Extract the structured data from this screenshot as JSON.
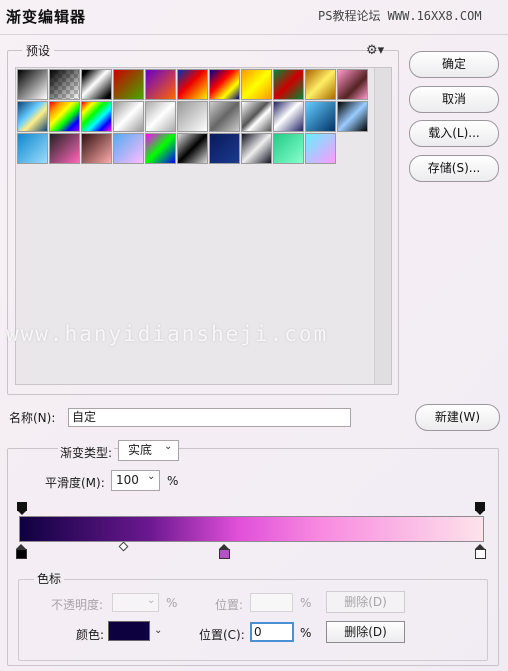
{
  "window": {
    "title": "渐变编辑器",
    "watermark": "PS教程论坛 WWW.16XX8.COM"
  },
  "presets": {
    "label": "预设",
    "menu_icon": "gear-icon",
    "swatches": [
      [
        "linear-gradient(135deg,#000 0%,#fff 100%)",
        "linear-gradient(135deg,#000 0%,transparent 100%)",
        "linear-gradient(135deg,#000 10%,#fff 45%,#000 90%)",
        "linear-gradient(135deg,#c00 0%,#4a0 100%)",
        "linear-gradient(135deg,#60c 0%,#f60 100%)",
        "linear-gradient(135deg,#03a 0%,#e00 45%,#fe0 100%)",
        "linear-gradient(135deg,#008 0%,#f00 40%,#ff0 70%,#008 100%)",
        "linear-gradient(135deg,#f90 0%,#ff0 50%,#f90 100%)",
        "linear-gradient(135deg,#083 0%,#c00 50%,#083 100%)",
        "linear-gradient(135deg,#a60 0%,#fe6 50%,#a60 100%)",
        "linear-gradient(135deg,#f9c 0%,#522 60%,#f9c 100%)"
      ],
      [
        "linear-gradient(135deg,#147 0%,#6cf 40%,#fe8 60%,#147 100%)",
        "linear-gradient(135deg,#f00,#f90,#ff0,#0f0,#00f,#90f)",
        "linear-gradient(135deg,#f00 0%,#ff0 20%,#0f0 40%,#0ff 60%,#00f 80%,#f0f 100%)",
        "linear-gradient(135deg,#999 0%,#fff 50%,#999 100%)",
        "linear-gradient(135deg,#aaa 0%,#fff 50%,#aaa 100%)",
        "linear-gradient(135deg,#999 0%,#fff 100%)",
        "linear-gradient(135deg,#ccc 0%,#666 50%,#ccc 100%)",
        "linear-gradient(135deg,#fff 0%,#555 45%,#fff 60%,#555 100%)",
        "linear-gradient(135deg,#226 0%,#fff 45%,#226 100%)",
        "linear-gradient(135deg,#6cf 0%,#036 100%)",
        "linear-gradient(135deg,#000 0%,#9cf 50%,#000 100%)"
      ],
      [
        "linear-gradient(135deg,#18c 0%,#9df 100%)",
        "linear-gradient(135deg,#222 0%,#f6b 100%)",
        "linear-gradient(135deg,#311 0%,#faa 100%)",
        "linear-gradient(135deg,#5ae 0%,#fbf 100%)",
        "linear-gradient(135deg,#f0f 0%,#0f0 50%,#00f 100%)",
        "linear-gradient(135deg,#ddd 0%,#000 50%,#ddd 100%)",
        "linear-gradient(135deg,#0a1a5c 0%,#1c3a90 100%)",
        "linear-gradient(135deg,#112 0%,#eee 50%,#112 100%)",
        "linear-gradient(135deg,#2c8 0%,#8fc 100%)",
        "linear-gradient(135deg,#6ef 0%,#f9f 100%)"
      ]
    ]
  },
  "buttons": {
    "ok": "确定",
    "cancel": "取消",
    "load": "载入(L)...",
    "save": "存储(S)...",
    "new": "新建(W)"
  },
  "name": {
    "label": "名称(N):",
    "value": "自定"
  },
  "gradient": {
    "type_label": "渐变类型:",
    "type_value": "实底",
    "smooth_label": "平滑度(M):",
    "smooth_value": "100",
    "smooth_unit": "%",
    "colors": [
      "#0e0140",
      "#6c1890",
      "#e04fd9",
      "#f88ae0",
      "#fde3ea"
    ]
  },
  "stops": {
    "label": "色标",
    "opacity_label": "不透明度:",
    "opacity_unit": "%",
    "opacity_position_label": "位置:",
    "opacity_position_unit": "%",
    "opacity_delete": "删除(D)",
    "color_label": "颜色:",
    "color_value": "#0e0140",
    "color_position_label": "位置(C):",
    "color_position_value": "0",
    "color_position_unit": "%",
    "color_delete": "删除(D)"
  },
  "watermark_overlay": "www.hanyidiansheji.com"
}
